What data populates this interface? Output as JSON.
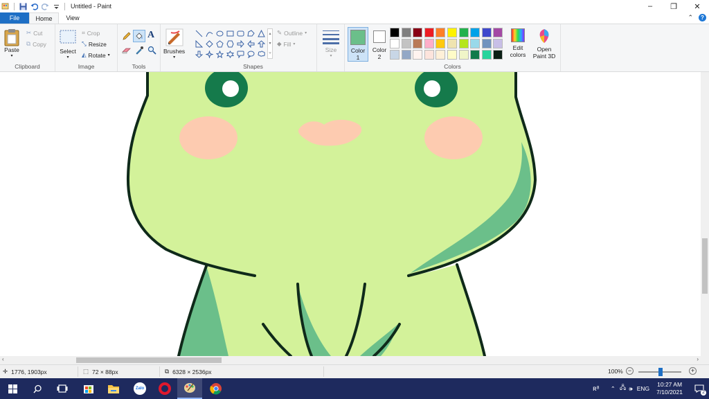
{
  "window": {
    "title": "Untitled - Paint",
    "controls": [
      "minimize",
      "restore",
      "close"
    ]
  },
  "tabs": [
    {
      "label": "File",
      "active": false
    },
    {
      "label": "Home",
      "active": true
    },
    {
      "label": "View",
      "active": false
    }
  ],
  "ribbon": {
    "clipboard": {
      "group_label": "Clipboard",
      "paste": "Paste",
      "cut": "Cut",
      "copy": "Copy"
    },
    "image": {
      "group_label": "Image",
      "select": "Select",
      "crop": "Crop",
      "resize": "Resize",
      "rotate": "Rotate"
    },
    "tools": {
      "group_label": "Tools",
      "items": [
        "pencil-icon",
        "fill-icon",
        "text-icon",
        "eraser-icon",
        "color-picker-icon",
        "magnifier-icon"
      ]
    },
    "brushes": {
      "label": "Brushes"
    },
    "shapes": {
      "group_label": "Shapes",
      "outline": "Outline",
      "fill": "Fill"
    },
    "size": {
      "label": "Size"
    },
    "colors": {
      "group_label": "Colors",
      "color1_label": "Color",
      "color1_num": "1",
      "color1_value": "#6bbf8a",
      "color2_label": "Color",
      "color2_num": "2",
      "color2_value": "#ffffff",
      "edit_colors_line1": "Edit",
      "edit_colors_line2": "colors",
      "palette": [
        "#000000",
        "#7f7f7f",
        "#880015",
        "#ed1c24",
        "#ff7f27",
        "#fff200",
        "#22b14c",
        "#00a2e8",
        "#3f48cc",
        "#a349a4",
        "#ffffff",
        "#c3c3c3",
        "#b97a57",
        "#ffaec9",
        "#ffc90e",
        "#efe4b0",
        "#b5e61d",
        "#99d9ea",
        "#7092be",
        "#c8bfe7",
        "#c8d6e6",
        "#93a8c6",
        "#fff3ef",
        "#fde4dc",
        "#fff0d8",
        "#fffcc8",
        "#f0f5c8",
        "#117a4a",
        "#26d49c",
        "#0b1f15"
      ]
    },
    "paint3d": {
      "line1": "Open",
      "line2": "Paint 3D"
    }
  },
  "status": {
    "cursor_position": "1776, 1903px",
    "selection_size": "72 × 88px",
    "image_size": "6328 × 2536px",
    "zoom": "100%"
  },
  "taskbar": {
    "apps": [
      "windows-start",
      "search",
      "task-view",
      "app-store",
      "file-explorer",
      "zalo",
      "opera",
      "paint",
      "chrome"
    ],
    "tray_lang": "ENG",
    "time": "10:27 AM",
    "date": "7/10/2021",
    "notification_count": "2"
  },
  "artwork": {
    "colors": {
      "body": "#d3f29a",
      "outline": "#0f2a1a",
      "eye": "#157a4b",
      "cheek": "#fdcbb0",
      "shade": "#6bbf8a"
    }
  }
}
